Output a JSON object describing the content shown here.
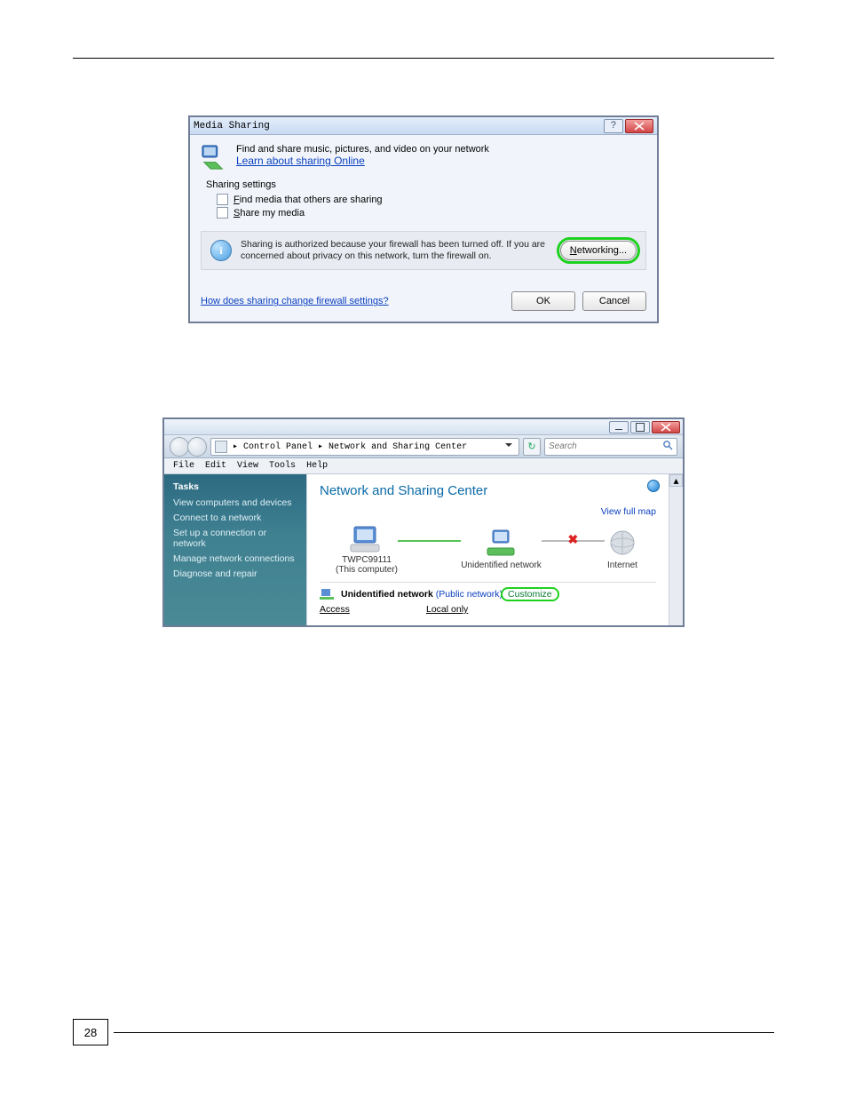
{
  "dlg1": {
    "title": "Media Sharing",
    "intro": "Find and share music, pictures, and video on your network",
    "intro_link": "Learn about sharing Online",
    "section": "Sharing settings",
    "chk_find": "Find media that others are sharing",
    "chk_share": "Share my media",
    "info_text": "Sharing is authorized because your firewall has been turned off. If you are concerned about privacy on this network, turn the firewall on.",
    "btn_networking": "Networking...",
    "footer_link": "How does sharing change firewall settings?",
    "btn_ok": "OK",
    "btn_cancel": "Cancel"
  },
  "w2": {
    "breadcrumb": " ▸ Control Panel ▸ Network and Sharing Center",
    "search_placeholder": "Search",
    "menu": {
      "file": "File",
      "edit": "Edit",
      "view": "View",
      "tools": "Tools",
      "help": "Help"
    },
    "tasks_header": "Tasks",
    "tasks": [
      "View computers and devices",
      "Connect to a network",
      "Set up a connection or network",
      "Manage network connections",
      "Diagnose and repair"
    ],
    "main_title": "Network and Sharing Center",
    "view_full_map": "View full map",
    "node_pc_name": "TWPC99111",
    "node_pc_caption": "(This computer)",
    "node_mid": "Unidentified network",
    "node_internet": "Internet",
    "net_label_bold": "Unidentified network",
    "net_label_paren": "(Public network)",
    "customize": "Customize",
    "access_k": "Access",
    "access_v": "Local only"
  },
  "page_number": "28"
}
